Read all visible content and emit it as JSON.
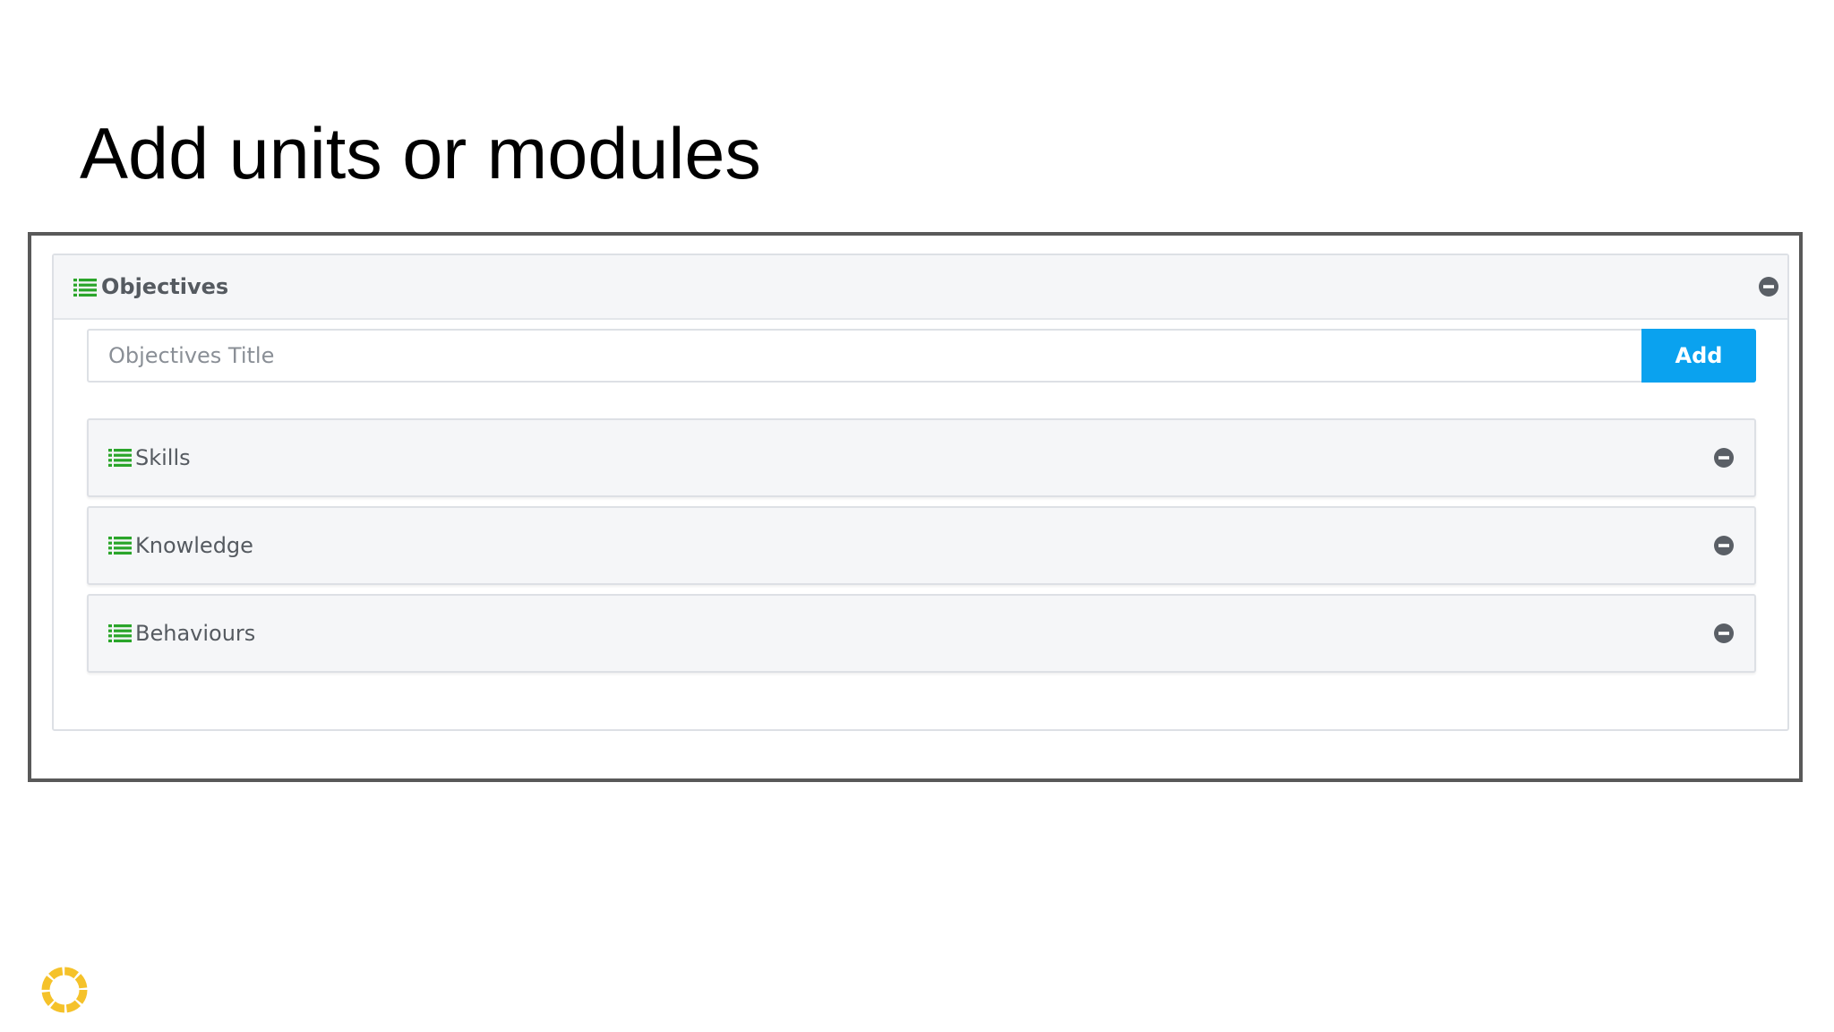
{
  "slide": {
    "title": "Add units or modules"
  },
  "panel": {
    "header_label": "Objectives",
    "input": {
      "placeholder": "Objectives Title",
      "value": ""
    },
    "add_button_label": "Add",
    "sections": [
      {
        "label": "Skills"
      },
      {
        "label": "Knowledge"
      },
      {
        "label": "Behaviours"
      }
    ]
  },
  "icons": {
    "list": "list-icon",
    "collapse": "minus-circle-icon",
    "logo": "ring-logo"
  },
  "colors": {
    "list_icon": "#2aa52a",
    "add_button": "#0aa2ef",
    "collapse_icon": "#5a5f66",
    "logo": "#f5c22a",
    "frame_border": "#595959"
  }
}
